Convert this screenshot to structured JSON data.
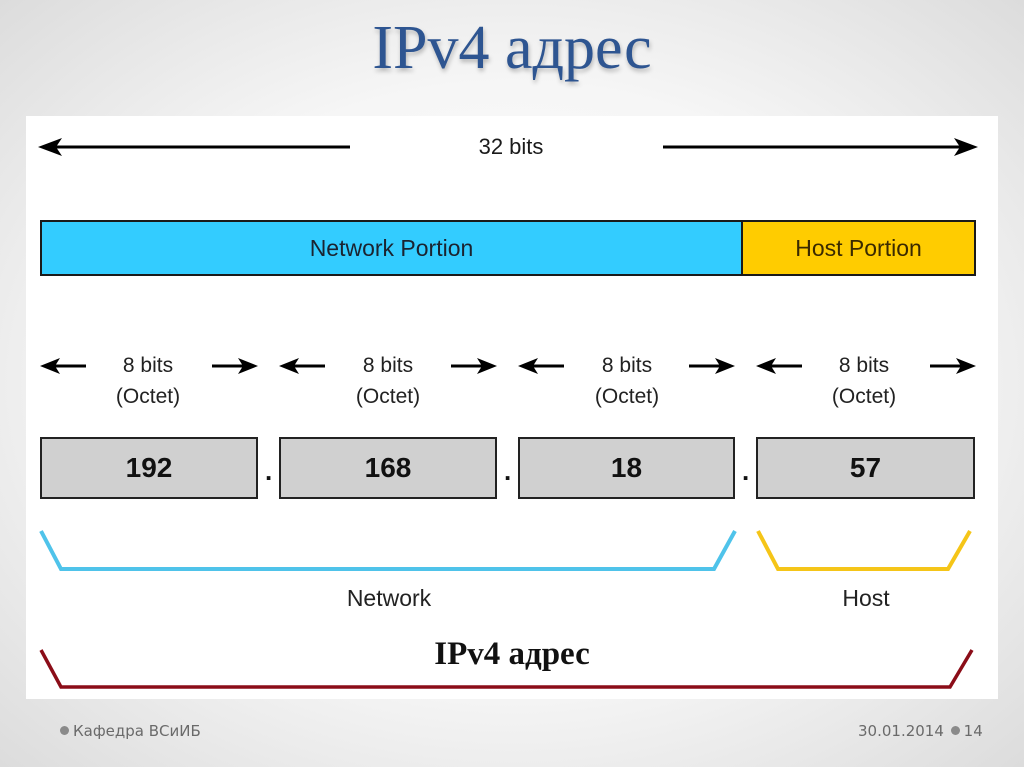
{
  "slide": {
    "title": "IPv4 адрес",
    "footer_left": "Кафедра ВСиИБ",
    "footer_date": "30.01.2014",
    "page_number": "14"
  },
  "diagram": {
    "total_bits_label": "32 bits",
    "network_portion_label": "Network Portion",
    "host_portion_label": "Host Portion",
    "octets": [
      {
        "bits_label": "8 bits",
        "unit_label": "(Octet)",
        "value": "192"
      },
      {
        "bits_label": "8 bits",
        "unit_label": "(Octet)",
        "value": "168"
      },
      {
        "bits_label": "8 bits",
        "unit_label": "(Octet)",
        "value": "18"
      },
      {
        "bits_label": "8 bits",
        "unit_label": "(Octet)",
        "value": "57"
      }
    ],
    "separator": ".",
    "network_bracket_label": "Network",
    "host_bracket_label": "Host",
    "address_bracket_label": "IPv4 адрес",
    "colors": {
      "network": "#33ccff",
      "host": "#ffcc00",
      "octet_box": "#d0d0d0",
      "network_bracket": "#4fc3ea",
      "host_bracket": "#f5c518",
      "address_bracket": "#8b0d18",
      "title": "#2e5591"
    }
  }
}
